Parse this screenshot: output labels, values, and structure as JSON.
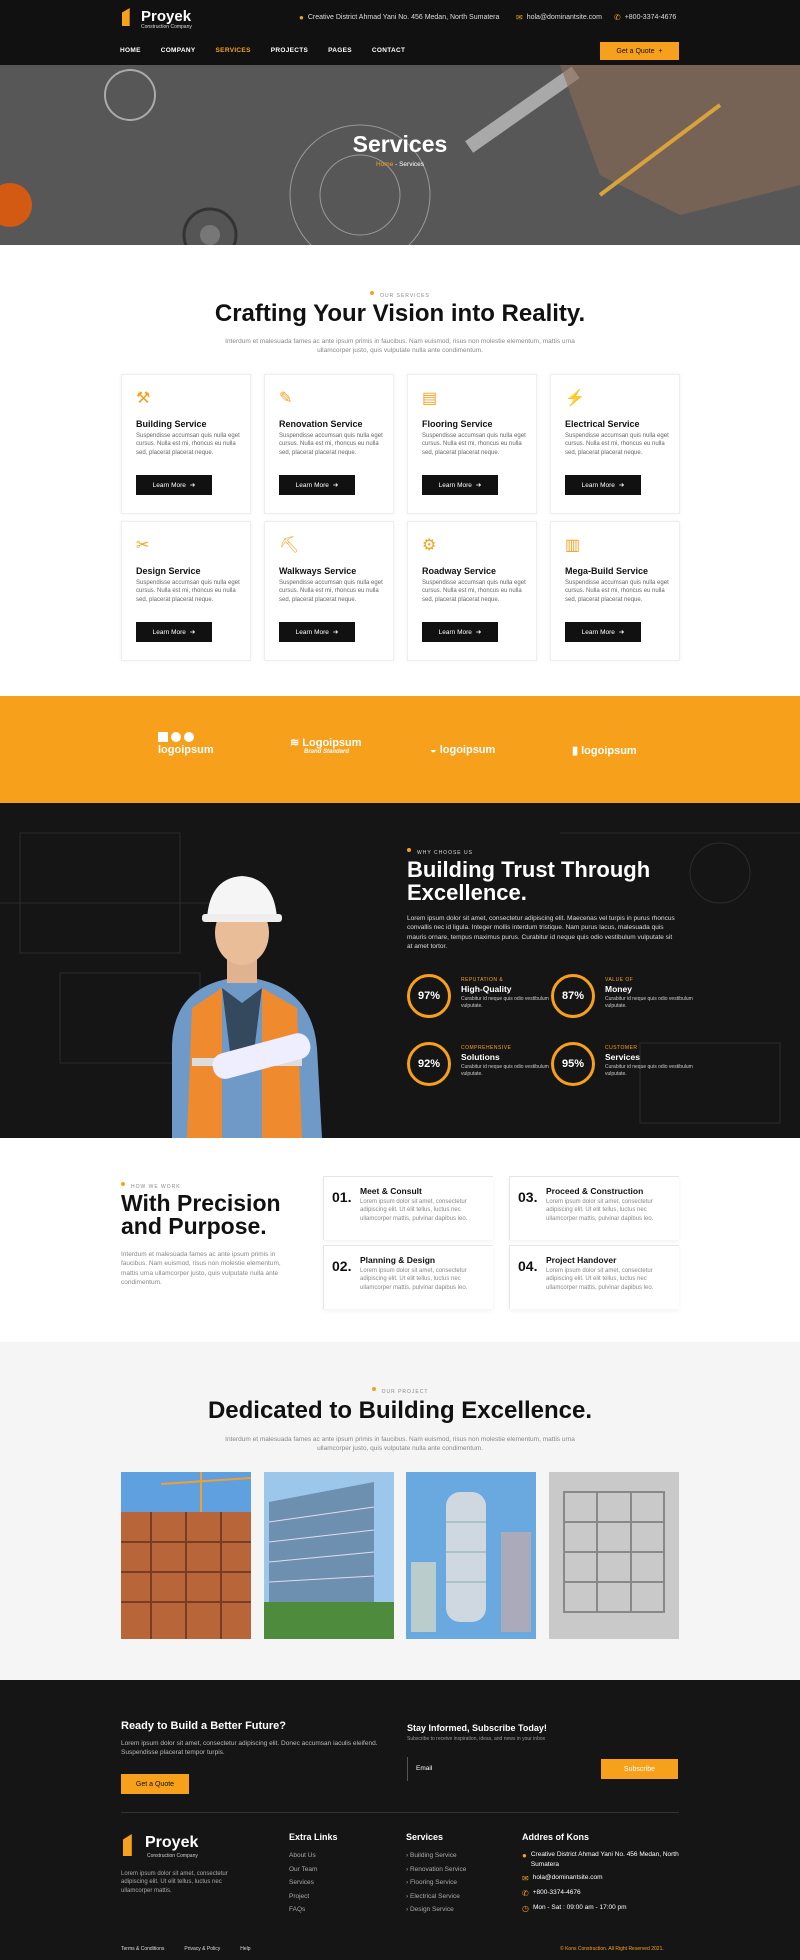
{
  "header": {
    "brand": "Proyek",
    "tagline": "Construction Company",
    "address": "Creative District Ahmad Yani No. 456 Medan, North Sumatera",
    "email": "hola@dominantsite.com",
    "phone": "+800-3374-4676",
    "nav": [
      "HOME",
      "COMPANY",
      "SERVICES",
      "PROJECTS",
      "PAGES",
      "CONTACT"
    ],
    "quote_label": "Get a Quote"
  },
  "hero": {
    "title": "Services",
    "crumb_home": "Home",
    "crumb_sep": " - ",
    "crumb_current": "Services"
  },
  "services": {
    "tag": "OUR SERVICES",
    "title": "Crafting Your Vision into Reality.",
    "lead": "Interdum et malesuada fames ac ante ipsum primis in faucibus. Nam euismod, risus non molestie elementum, mattis urna ullamcorper justo, quis vulputate nulla ante condimentum.",
    "card_desc": "Suspendisse accumsan quis nulla eget cursus. Nulla est mi, rhoncus eu nulla sed, placerat placerat neque.",
    "button": "Learn More",
    "items": [
      "Building Service",
      "Renovation Service",
      "Flooring Service",
      "Electrical Service",
      "Design Service",
      "Walkways Service",
      "Roadway Service",
      "Mega-Build Service"
    ]
  },
  "partners": [
    "logoipsum",
    "Logoipsum",
    "logoipsum",
    "logoipsum"
  ],
  "partner_sub": "Brand Standard",
  "why": {
    "tag": "WHY CHOOSE US",
    "title1": "Building Trust Through",
    "title2": "Excellence.",
    "text": "Lorem ipsum dolor sit amet, consectetur adipiscing elit. Maecenas vel turpis in purus rhoncus convallis nec id ligula. Integer mollis interdum tristique. Nam purus lacus, malesuada quis mauris ornare, tempus maximus purus. Curabitur id neque quis odio vestibulum vulputate sit at amet tortor.",
    "stat_desc": "Curabitur id neque quis odio vestibulum vulputate.",
    "stats": [
      {
        "value": "97%",
        "label": "REPUTATION &",
        "title": "High-Quality"
      },
      {
        "value": "87%",
        "label": "VALUE OF",
        "title": "Money"
      },
      {
        "value": "92%",
        "label": "COMPREHENSIVE",
        "title": "Solutions"
      },
      {
        "value": "95%",
        "label": "CUSTOMER",
        "title": "Services"
      }
    ]
  },
  "process": {
    "tag": "HOW WE WORK",
    "title1": "With Precision",
    "title2": "and Purpose.",
    "text": "Interdum et malesuada fames ac ante ipsum primis in faucibus. Nam euismod, risus non molestie elementum, mattis urna ullamcorper justo, quis vulputate nulla ante condimentum.",
    "step_desc": "Lorem ipsum dolor sit amet, consectetur adipiscing elit. Ut elit tellus, luctus nec ullamcorper mattis, pulvinar dapibus leo.",
    "steps": [
      {
        "num": "01.",
        "title": "Meet & Consult"
      },
      {
        "num": "03.",
        "title": "Proceed & Construction"
      },
      {
        "num": "02.",
        "title": "Planning & Design"
      },
      {
        "num": "04.",
        "title": "Project Handover"
      }
    ]
  },
  "projects": {
    "tag": "OUR PROJECT",
    "title": "Dedicated to Building Excellence.",
    "lead": "Interdum et malesuada fames ac ante ipsum primis in faucibus. Nam euismod, risus non molestie elementum, mattis urna ullamcorper justo, quis vulputate nulla ante condimentum."
  },
  "footer": {
    "cta_title": "Ready to Build a Better Future?",
    "cta_text": "Lorem ipsum dolor sit amet, consectetur adipiscing elit. Donec accumsan iaculis eleifend. Suspendisse placerat tempor turpis.",
    "cta_button": "Get a Quote",
    "sub_title": "Stay Informed, Subscribe Today!",
    "sub_text": "Subscribe to receive inspiration, ideas, and news in your inbox",
    "email_placeholder": "Email",
    "subscribe": "Subscribe",
    "brand": "Proyek",
    "tagline": "Construction Company",
    "about": "Lorem ipsum dolor sit amet, consectetur adipiscing elit. Ut elit tellus, luctus nec ullamcorper mattis.",
    "links_title": "Extra Links",
    "links": [
      "About Us",
      "Our Team",
      "Services",
      "Project",
      "FAQs"
    ],
    "services_title": "Services",
    "services": [
      "Building Service",
      "Renovation Service",
      "Flooring Service",
      "Electrical Service",
      "Design Service"
    ],
    "addr_title": "Addres of Kons",
    "addr": "Creative District Ahmad Yani No. 456 Medan, North Sumatera",
    "email": "hola@dominantsite.com",
    "phone": "+800-3374-4676",
    "hours": "Mon - Sat : 09:00 am - 17:00 pm",
    "bottom_links": [
      "Terms & Conditions",
      "Privacy & Policy",
      "Help"
    ],
    "copyright": "© Kons Construction. All Right Reserved 2021."
  },
  "colors": {
    "accent": "#f7a01c",
    "dark": "#151515"
  }
}
